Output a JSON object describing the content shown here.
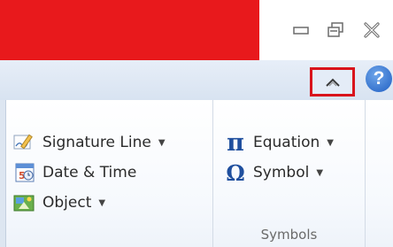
{
  "window": {
    "controls": [
      "minimize-icon",
      "restore-icon",
      "close-icon"
    ]
  },
  "ribbon": {
    "collapse_icon": "chevron-up-icon",
    "help_glyph": "?"
  },
  "text_group": {
    "items": [
      {
        "label": "Signature Line",
        "icon": "signature-line-icon",
        "has_dropdown": true
      },
      {
        "label": "Date & Time",
        "icon": "calendar-icon",
        "has_dropdown": false
      },
      {
        "label": "Object",
        "icon": "object-icon",
        "has_dropdown": true
      }
    ]
  },
  "symbols_group": {
    "items": [
      {
        "label": "Equation",
        "glyph": "π",
        "has_dropdown": true
      },
      {
        "label": "Symbol",
        "glyph": "Ω",
        "has_dropdown": true
      }
    ],
    "group_label": "Symbols"
  },
  "colors": {
    "title_red": "#e8191c",
    "highlight_red": "#d9141c",
    "help_blue": "#1f5fc3",
    "equation_blue": "#1f4f9e"
  }
}
